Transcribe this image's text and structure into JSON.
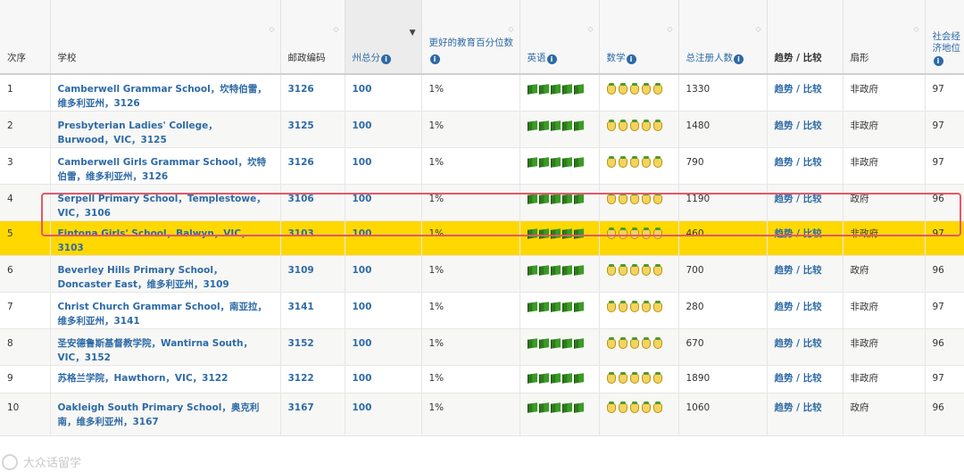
{
  "headers": {
    "rank": "次序",
    "school": "学校",
    "postcode": "邮政编码",
    "state": "州总分",
    "percentile": "更好的教育百分位数",
    "english": "英语",
    "math": "数学",
    "enrolment": "总注册人数",
    "trend": "趋势 / 比较",
    "sector": "扇形",
    "socio": "社会经济地位"
  },
  "rows": [
    {
      "rank": "1",
      "school": "Camberwell Grammar School，坎特伯雷，维多利亚州，3126",
      "postcode": "3126",
      "state": "100",
      "percentile": "1%",
      "enrolment": "1330",
      "trend": "趋势 / 比较",
      "sector": "非政府",
      "socio": "97"
    },
    {
      "rank": "2",
      "school": "Presbyterian Ladies' College，Burwood，VIC，3125",
      "postcode": "3125",
      "state": "100",
      "percentile": "1%",
      "enrolment": "1480",
      "trend": "趋势 / 比较",
      "sector": "非政府",
      "socio": "97"
    },
    {
      "rank": "3",
      "school": "Camberwell Girls Grammar School，坎特伯雷，维多利亚州，3126",
      "postcode": "3126",
      "state": "100",
      "percentile": "1%",
      "enrolment": "790",
      "trend": "趋势 / 比较",
      "sector": "非政府",
      "socio": "97"
    },
    {
      "rank": "4",
      "school": "Serpell Primary School，Templestowe，VIC，3106",
      "postcode": "3106",
      "state": "100",
      "percentile": "1%",
      "enrolment": "1190",
      "trend": "趋势 / 比较",
      "sector": "政府",
      "socio": "96"
    },
    {
      "rank": "5",
      "school": "Fintona Girls' School，Balwyn，VIC，3103",
      "postcode": "3103",
      "state": "100",
      "percentile": "1%",
      "enrolment": "460",
      "trend": "趋势 / 比较",
      "sector": "非政府",
      "socio": "97"
    },
    {
      "rank": "6",
      "school": "Beverley Hills Primary School，Doncaster East，维多利亚州，3109",
      "postcode": "3109",
      "state": "100",
      "percentile": "1%",
      "enrolment": "700",
      "trend": "趋势 / 比较",
      "sector": "政府",
      "socio": "96"
    },
    {
      "rank": "7",
      "school": "Christ Church Grammar School，南亚拉，维多利亚州，3141",
      "postcode": "3141",
      "state": "100",
      "percentile": "1%",
      "enrolment": "280",
      "trend": "趋势 / 比较",
      "sector": "非政府",
      "socio": "97"
    },
    {
      "rank": "8",
      "school": "圣安德鲁斯基督教学院，Wantirna South，VIC，3152",
      "postcode": "3152",
      "state": "100",
      "percentile": "1%",
      "enrolment": "670",
      "trend": "趋势 / 比较",
      "sector": "非政府",
      "socio": "96"
    },
    {
      "rank": "9",
      "school": "苏格兰学院，Hawthorn，VIC，3122",
      "postcode": "3122",
      "state": "100",
      "percentile": "1%",
      "enrolment": "1890",
      "trend": "趋势 / 比较",
      "sector": "非政府",
      "socio": "97"
    },
    {
      "rank": "10",
      "school": "Oakleigh South Primary School，奥克利南，维多利亚州，3167",
      "postcode": "3167",
      "state": "100",
      "percentile": "1%",
      "enrolment": "1060",
      "trend": "趋势 / 比较",
      "sector": "政府",
      "socio": "96"
    }
  ],
  "english_rating": 5,
  "math_rating": 5,
  "highlighted_row": "5",
  "icons": {
    "info": "info-icon",
    "english": "book-icon",
    "math": "apple-icon",
    "sort": "sort-icon"
  },
  "colors": {
    "link": "#2d6aa6",
    "highlight": "#ffd800",
    "frame": "#e4586a",
    "book": "#2e7a1c",
    "apple": "#f4d35e"
  },
  "watermark": "大众话留学"
}
